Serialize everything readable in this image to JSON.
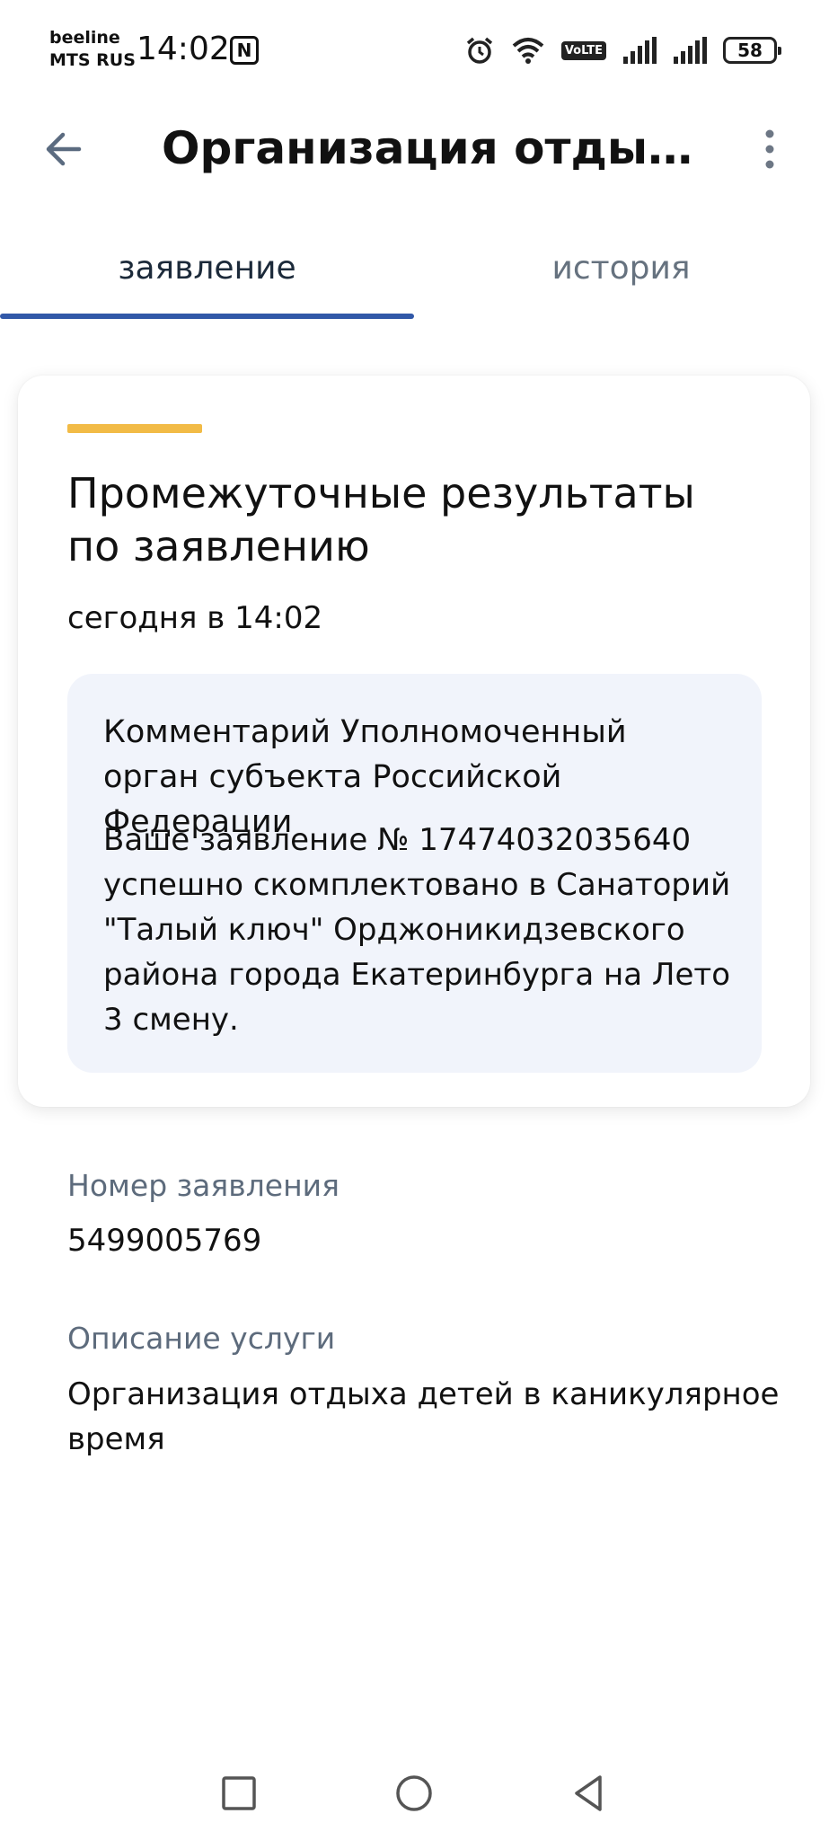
{
  "status_bar": {
    "carrier_1": "beeline",
    "carrier_2": "MTS RUS",
    "time": "14:02",
    "nfc_icon": "N",
    "volte": "VoLTE",
    "battery": "58"
  },
  "app_bar": {
    "title": "Организация отдыха д..."
  },
  "tabs": [
    {
      "label": "заявление",
      "active": true
    },
    {
      "label": "история",
      "active": false
    }
  ],
  "card": {
    "title": "Промежуточные результаты по заявлению",
    "date": "сегодня в 14:02",
    "comment_heading": "Комментарий Уполномоченный орган субъекта Российской Федерации",
    "comment_text": "Ваше заявление № 17474032035640 успешно скомплектовано в Санаторий \"Талый ключ\" Орджоникидзевского района города Екатеринбурга на Лето 3 смену."
  },
  "details": {
    "number_label": "Номер заявления",
    "number_value": "5499005769",
    "description_label": "Описание услуги",
    "description_value": "Организация отдыха детей в каникулярное время"
  },
  "colors": {
    "accent_yellow": "#f2bb46",
    "tab_indicator": "#3158a8",
    "comment_bg": "#f1f4fb",
    "label_gray": "#5d6b7c"
  },
  "icons": {
    "back": "arrow-left-icon",
    "more": "more-vertical-icon",
    "nav_recent": "square-icon",
    "nav_home": "circle-icon",
    "nav_back": "triangle-back-icon"
  }
}
